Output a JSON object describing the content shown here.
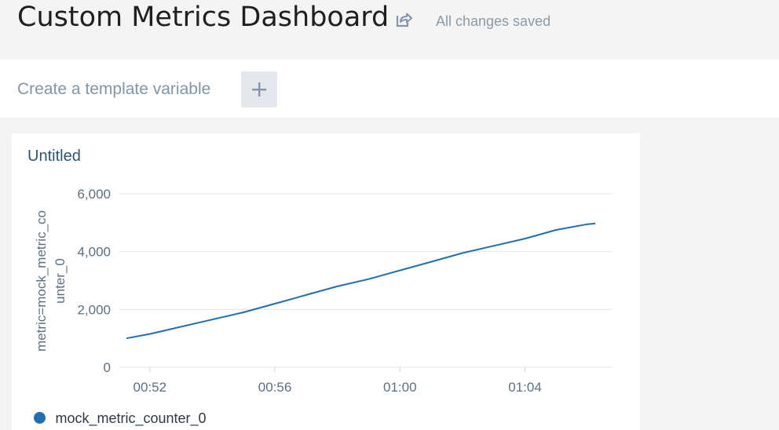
{
  "header": {
    "title": "Custom Metrics Dashboard",
    "share_icon": "share-icon",
    "save_status": "All changes saved"
  },
  "template_bar": {
    "label": "Create a template variable",
    "add_icon": "plus-icon"
  },
  "panel": {
    "title": "Untitled"
  },
  "colors": {
    "series": "#1f6fb2",
    "grid": "#e4e4e4",
    "muted_text": "#8a9aa9",
    "panel_title": "#2f5478"
  },
  "chart_data": {
    "type": "line",
    "title": "Untitled",
    "xlabel": "",
    "ylabel": "metric=mock_metric_counter_0",
    "ylabel_lines": [
      "metric=mock_metric_co",
      "unter_0"
    ],
    "ylim": [
      0,
      6000
    ],
    "yticks": [
      0,
      2000,
      4000,
      6000
    ],
    "ytick_labels": [
      "0",
      "2,000",
      "4,000",
      "6,000"
    ],
    "x_minutes": [
      51.25,
      52.0,
      53.0,
      54.0,
      55.0,
      56.0,
      57.0,
      58.0,
      59.0,
      60.0,
      61.0,
      62.0,
      63.0,
      64.0,
      65.0,
      66.0,
      66.25
    ],
    "xticks": [
      52,
      56,
      60,
      64
    ],
    "xtick_labels": [
      "00:52",
      "00:56",
      "01:00",
      "01:04"
    ],
    "xlim": [
      51.0,
      66.8
    ],
    "grid": true,
    "legend_position": "bottom-left",
    "series": [
      {
        "name": "mock_metric_counter_0",
        "values": [
          1000,
          1150,
          1400,
          1650,
          1900,
          2200,
          2500,
          2800,
          3050,
          3350,
          3650,
          3950,
          4200,
          4450,
          4750,
          4950,
          4970
        ]
      }
    ]
  }
}
